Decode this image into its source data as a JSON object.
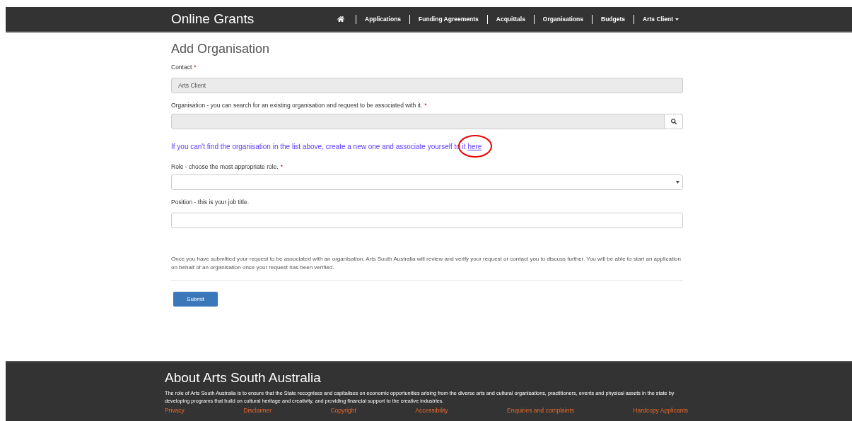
{
  "brand": "Online Grants",
  "nav": [
    {
      "label": "Applications",
      "kind": "link"
    },
    {
      "label": "Funding Agreements",
      "kind": "link"
    },
    {
      "label": "Acquittals",
      "kind": "link"
    },
    {
      "label": "Organisations",
      "kind": "link"
    },
    {
      "label": "Budgets",
      "kind": "link"
    },
    {
      "label": "Arts Client",
      "kind": "dropdown"
    }
  ],
  "page_title": "Add Organisation",
  "fields": [
    {
      "label": "Contact",
      "required_mark": "*",
      "kind": "text",
      "value": "Arts Client",
      "disabled": true
    },
    {
      "label": "Organisation - you can search for an existing organisation and request to be associated with it.",
      "required_mark": "*",
      "kind": "search",
      "disabled": true
    },
    {
      "kind": "note",
      "text": "If you can't find the organisation in the list above, create a new one and associate yourself to it",
      "link": "here",
      "circled": true
    },
    {
      "label": "Role - choose the most appropriate role.",
      "required_mark": "*",
      "kind": "select",
      "disabled": false
    },
    {
      "label": "Position - this is your job title.",
      "kind": "text",
      "disabled": false
    }
  ],
  "info": "Once you have submitted your request to be associated with an organisation, Arts South Australia will review and verify your request or contact you to discuss further. You will be able to start an application on behalf of an organisation once your request has been verified.",
  "submit": "Submit",
  "footer": {
    "title": "About Arts South Australia",
    "text": "The role of Arts South Australia is to ensure that the State recognises and capitalises on economic opportunities arising from the diverse arts and cultural organisations, practitioners, events and physical assets in the state by developing programs that build on cultural heritage and creativity, and providing financial support to the creative industries.",
    "links": [
      "Privacy",
      "Disclaimer",
      "Copyright",
      "Accessibility",
      "Enquiries and complaints",
      "Hardcopy Applicants"
    ]
  }
}
